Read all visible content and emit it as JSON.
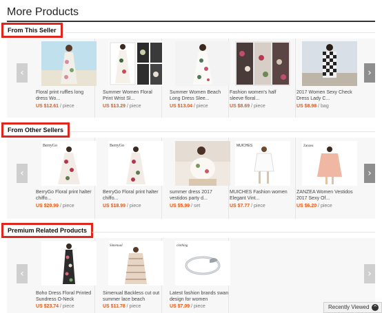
{
  "page": {
    "title": "More Products"
  },
  "sections": [
    {
      "header": "From This Seller",
      "products": [
        {
          "title": "Floral print ruffles long dress Wo...",
          "price": "US $12.61",
          "unit": "/ piece"
        },
        {
          "title": "Summer Women Floral Print Wrist Sl...",
          "price": "US $13.29",
          "unit": "/ piece"
        },
        {
          "title": "Summer Women Beach Long Dress Slee...",
          "price": "US $13.04",
          "unit": "/ piece"
        },
        {
          "title": "Fashion women's half sleeve floral...",
          "price": "US $8.69",
          "unit": "/ piece"
        },
        {
          "title": "2017 Women Sexy Check Dress Lady C...",
          "price": "US $8.98",
          "unit": "/ bag"
        }
      ]
    },
    {
      "header": "From Other Sellers",
      "products": [
        {
          "title": "BerryGo Floral print halter chiffo...",
          "price": "US $20.99",
          "unit": "/ piece",
          "brand": "BerryGo"
        },
        {
          "title": "BerryGo Floral print halter chiffo...",
          "price": "US $18.99",
          "unit": "/ piece",
          "brand": "BerryGo"
        },
        {
          "title": "summer dress 2017 vestidos party d...",
          "price": "US $5.99",
          "unit": "/ set"
        },
        {
          "title": "MUICHES Fashion women Elegant Vint...",
          "price": "US $7.77",
          "unit": "/ piece",
          "brand": "MUICHES"
        },
        {
          "title": "ZANZEA Women Vestidos 2017 Sexy Of...",
          "price": "US $6.20",
          "unit": "/ piece",
          "brand": "Zanzea"
        }
      ]
    },
    {
      "header": "Premium Related Products",
      "products": [
        {
          "title": "Boho Dress Floral Printed Sundress O-Neck",
          "price": "US $23.74",
          "unit": "/ piece"
        },
        {
          "title": "Simenual Backless cut out summer lace beach",
          "price": "US $11.78",
          "unit": "/ piece",
          "brand": "Simenual"
        },
        {
          "title": "Latest fashion brands swan design for women",
          "price": "US $7.09",
          "unit": "/ piece",
          "brand": "clothing"
        }
      ]
    }
  ],
  "nav": {
    "prev": "‹",
    "next": "›"
  },
  "recently_viewed": {
    "label": "Recently Viewed",
    "icon": "chevron-up-icon"
  },
  "colors": {
    "accent_red": "#e0251d",
    "price_orange": "#e25a1c"
  }
}
